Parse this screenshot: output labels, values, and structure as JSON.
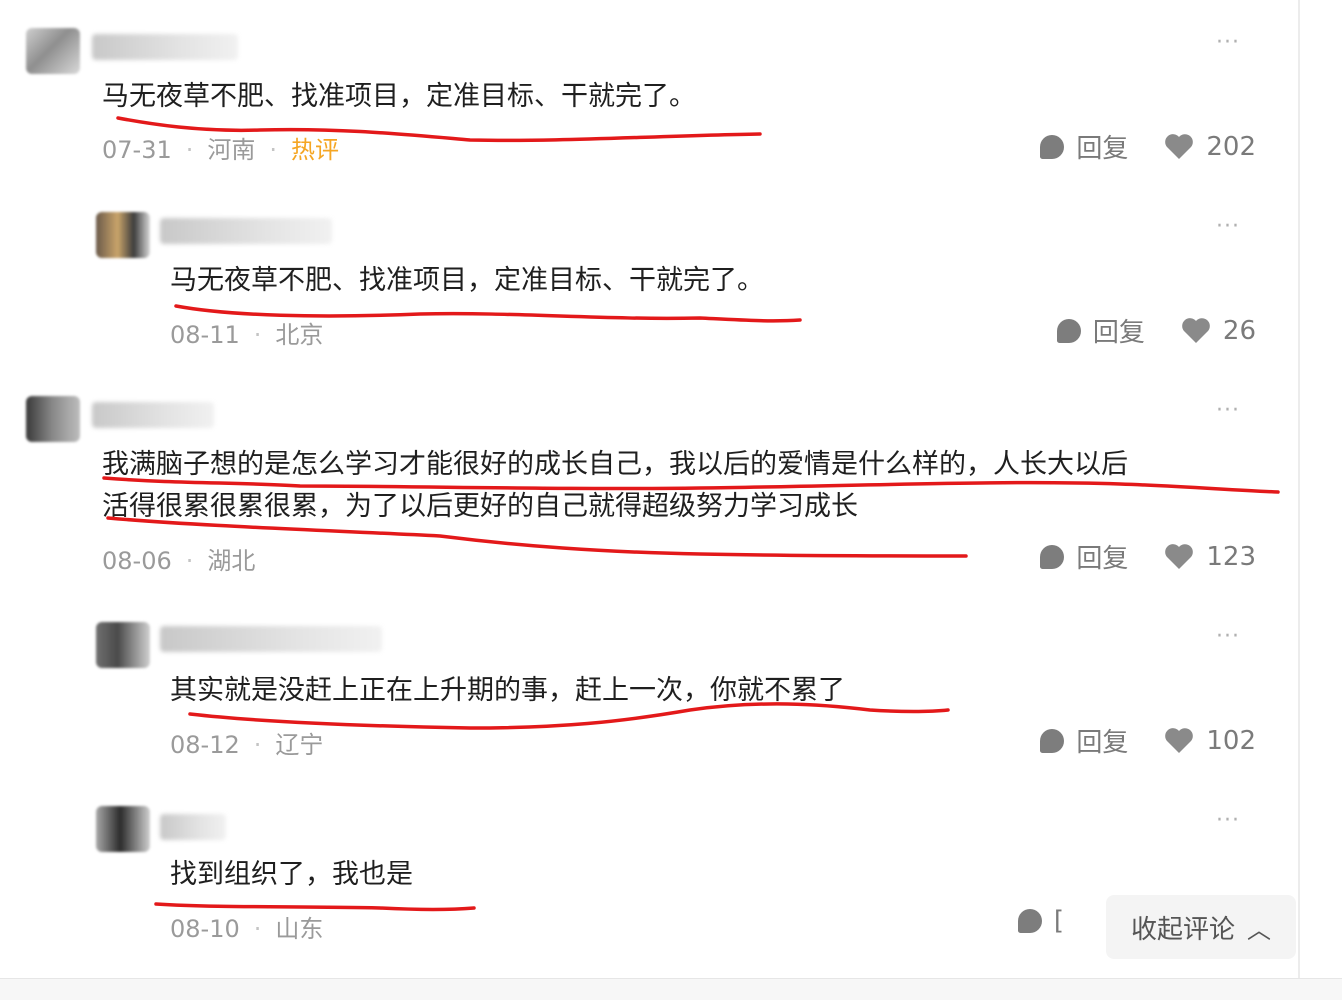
{
  "comments": [
    {
      "text": "马无夜草不肥、找准项目，定准目标、干就完了。",
      "date": "07-31",
      "location": "河南",
      "tag": "热评",
      "reply_label": "回复",
      "likes": "202",
      "more": "···"
    },
    {
      "text": "马无夜草不肥、找准项目，定准目标、干就完了。",
      "date": "08-11",
      "location": "北京",
      "reply_label": "回复",
      "likes": "26",
      "more": "···"
    },
    {
      "text_line1": "我满脑子想的是怎么学习才能很好的成长自己，我以后的爱情是什么样的，人长大以后",
      "text_line2": "活得很累很累很累，为了以后更好的自己就得超级努力学习成长",
      "date": "08-06",
      "location": "湖北",
      "reply_label": "回复",
      "likes": "123",
      "more": "···"
    },
    {
      "text": "其实就是没赶上正在上升期的事，赶上一次，你就不累了",
      "date": "08-12",
      "location": "辽宁",
      "reply_label": "回复",
      "likes": "102",
      "more": "···"
    },
    {
      "text": "找到组织了，我也是",
      "date": "08-10",
      "location": "山东",
      "reply_partial": "[",
      "more": "···"
    }
  ],
  "collapse_button": {
    "label": "收起评论",
    "icon": "chevron-up-icon"
  },
  "colors": {
    "highlight": "#e3191a",
    "hot_tag": "#f5a623",
    "meta": "#9a9a9a"
  },
  "icons": {
    "reply": "comment-bubble-icon",
    "like": "heart-icon",
    "more": "more-dots-icon"
  }
}
